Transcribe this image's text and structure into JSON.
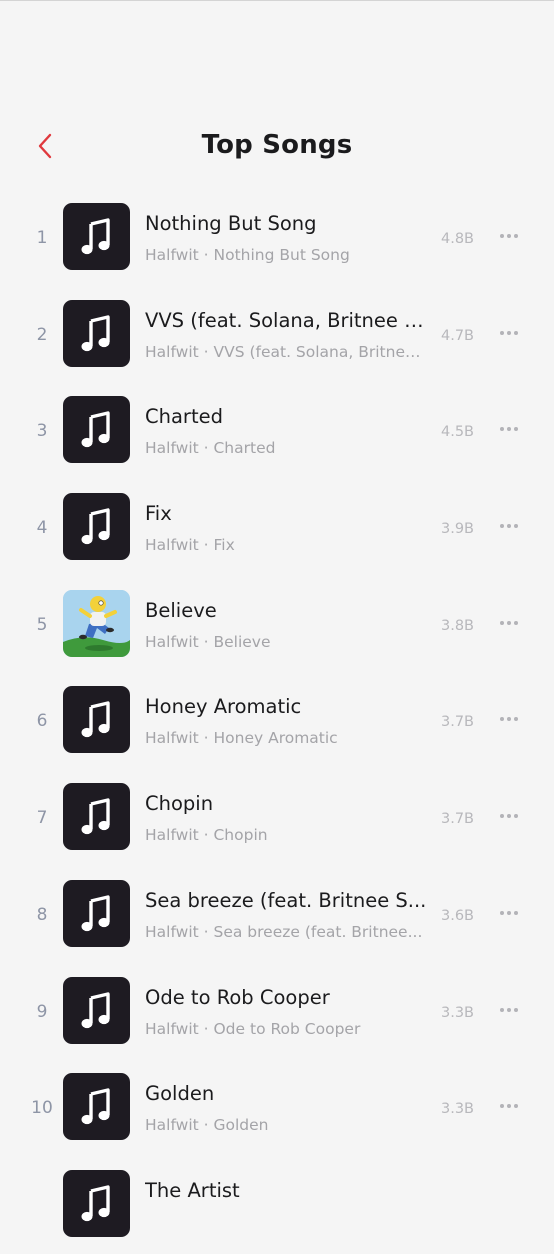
{
  "header": {
    "title": "Top Songs",
    "back_icon": "chevron-left-icon",
    "accent_color": "#e0393e"
  },
  "songs": [
    {
      "rank": "1",
      "title": "Nothing But Song",
      "subtitle": "Halfwit · Nothing But Song",
      "plays": "4.8B",
      "artwork": "music-note-icon"
    },
    {
      "rank": "2",
      "title": "VVS (feat. Solana, Britnee S...",
      "subtitle": "Halfwit · VVS (feat. Solana, Britnee...",
      "plays": "4.7B",
      "artwork": "music-note-icon"
    },
    {
      "rank": "3",
      "title": "Charted",
      "subtitle": "Halfwit · Charted",
      "plays": "4.5B",
      "artwork": "music-note-icon"
    },
    {
      "rank": "4",
      "title": "Fix",
      "subtitle": "Halfwit · Fix",
      "plays": "3.9B",
      "artwork": "music-note-icon"
    },
    {
      "rank": "5",
      "title": "Believe",
      "subtitle": "Halfwit · Believe",
      "plays": "3.8B",
      "artwork": "cartoon-character-image"
    },
    {
      "rank": "6",
      "title": "Honey Aromatic",
      "subtitle": "Halfwit · Honey Aromatic",
      "plays": "3.7B",
      "artwork": "music-note-icon"
    },
    {
      "rank": "7",
      "title": "Chopin",
      "subtitle": "Halfwit · Chopin",
      "plays": "3.7B",
      "artwork": "music-note-icon"
    },
    {
      "rank": "8",
      "title": "Sea breeze (feat. Britnee S...",
      "subtitle": "Halfwit · Sea breeze (feat. Britnee...",
      "plays": "3.6B",
      "artwork": "music-note-icon"
    },
    {
      "rank": "9",
      "title": "Ode to Rob Cooper",
      "subtitle": "Halfwit · Ode to Rob Cooper",
      "plays": "3.3B",
      "artwork": "music-note-icon"
    },
    {
      "rank": "10",
      "title": "Golden",
      "subtitle": "Halfwit · Golden",
      "plays": "3.3B",
      "artwork": "music-note-icon"
    },
    {
      "rank": "",
      "title": "The Artist",
      "subtitle": "",
      "plays": "",
      "artwork": "music-note-icon"
    }
  ],
  "more_icon": "more-horizontal-icon"
}
